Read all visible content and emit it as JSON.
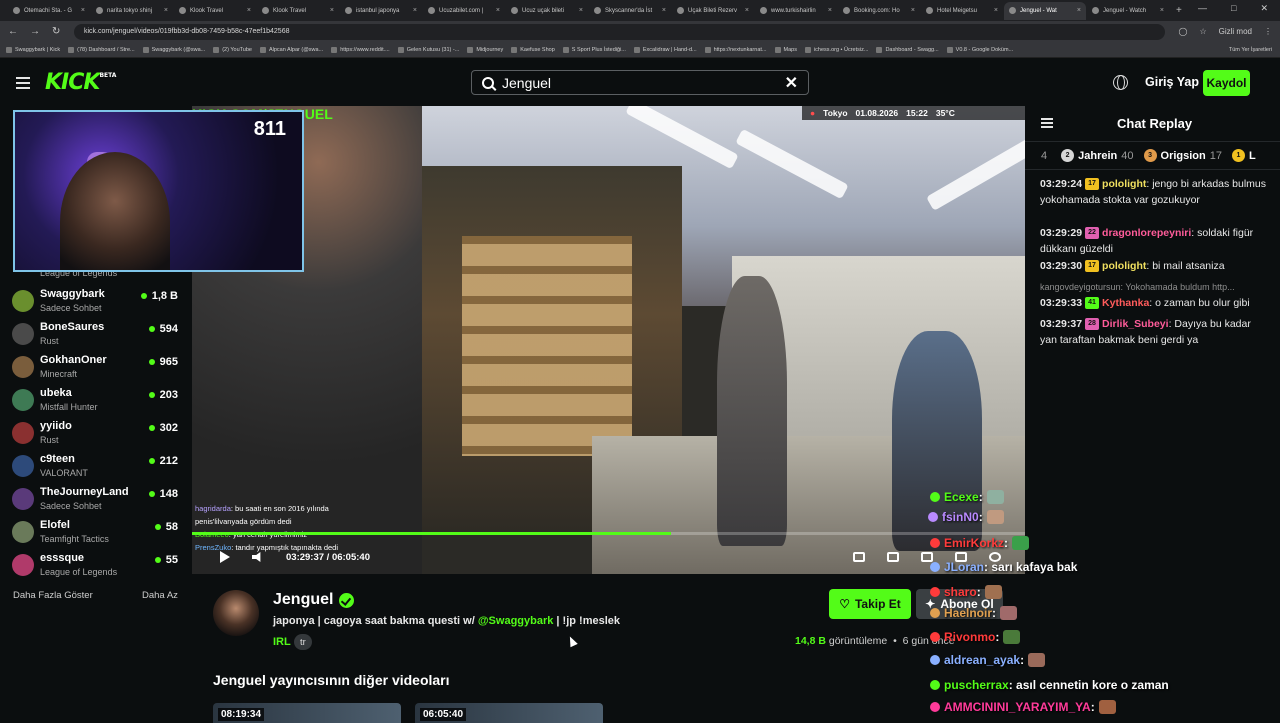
{
  "browser": {
    "tabs": [
      {
        "label": "Otemachi Sta. - G"
      },
      {
        "label": "narita tokyo shinj"
      },
      {
        "label": "Klook Travel"
      },
      {
        "label": "Klook Travel"
      },
      {
        "label": "istanbul japonya"
      },
      {
        "label": "Ucuzabilet.com |"
      },
      {
        "label": "Ucuz uçak bileti"
      },
      {
        "label": "Skyscanner'da İst"
      },
      {
        "label": "Uçak Bileti Rezerv"
      },
      {
        "label": "www.turkishairlin"
      },
      {
        "label": "Booking.com: Ho"
      },
      {
        "label": "Hotel Meigetsu"
      },
      {
        "label": "Jenguel - Wat"
      },
      {
        "label": "Jenguel - Watch"
      }
    ],
    "active_tab_index": 12,
    "url": "kick.com/jenguel/videos/019fbb3d-db08-7459-b58c-47eef1b42568",
    "profile_label": "Gizli mod",
    "bookmarks": [
      "Swaggybark | Kick",
      "(78) Dashboard / Stre...",
      "Swaggybark (@swa...",
      "(2) YouTube",
      "Alpcan Alpar (@swa...",
      "https://www.reddit....",
      "Gelen Kutusu (31) -...",
      "Midjourney",
      "Kaefuse Shop",
      "S Sport Plus İstediği...",
      "Excalidraw | Hand-d...",
      "https://nextunkarnat...",
      "Maps",
      "ichess.org • Ücretsiz...",
      "Dashboard - Swagg...",
      "V0.8 - Google Doküm..."
    ],
    "bookmarks_right": "Tüm Yer İşaretleri"
  },
  "header": {
    "logo": "KICK",
    "logo_sup": "BETA",
    "search_value": "Jenguel",
    "login_label": "Giriş Yap",
    "signup_label": "Kaydol"
  },
  "webcam": {
    "count": "811"
  },
  "sidebar": {
    "top_category": "League of Legends",
    "channels": [
      {
        "name": "Swaggybark",
        "category": "Sadece Sohbet",
        "viewers": "1,8 B",
        "color": "#6a8f2e"
      },
      {
        "name": "BoneSaures",
        "category": "Rust",
        "viewers": "594",
        "color": "#4a4a4a"
      },
      {
        "name": "GokhanOner",
        "category": "Minecraft",
        "viewers": "965",
        "color": "#7a5d3c"
      },
      {
        "name": "ubeka",
        "category": "Mistfall Hunter",
        "viewers": "203",
        "color": "#3e7a54"
      },
      {
        "name": "yyiido",
        "category": "Rust",
        "viewers": "302",
        "color": "#8a3030"
      },
      {
        "name": "c9teen",
        "category": "VALORANT",
        "viewers": "212",
        "color": "#2d4a7a"
      },
      {
        "name": "TheJourneyLand",
        "category": "Sadece Sohbet",
        "viewers": "148",
        "color": "#5a3a7a"
      },
      {
        "name": "Elofel",
        "category": "Teamfight Tactics",
        "viewers": "58",
        "color": "#6a7a5a"
      },
      {
        "name": "esssque",
        "category": "League of Legends",
        "viewers": "55",
        "color": "#b03a6a"
      }
    ],
    "show_more": "Daha Fazla Göster",
    "show_less": "Daha Az"
  },
  "player": {
    "overlay_brand": "KICK.COM/JENGUEL",
    "location": "Tokyo",
    "date": "01.08.2026",
    "clock": "15:22",
    "temperature": "35°C",
    "overlay_chat": [
      {
        "user": "hagridarda",
        "text": ": bu saati en son 2016 yılında"
      },
      {
        "user": "",
        "text": "penis'lilvanyada gördüm dedi"
      },
      {
        "user": "Bolamee0",
        "text": ": yan cenah yürelimimiz"
      },
      {
        "user": "PrensZuko",
        "text": ": tandır yapmıştık tapınakta dedi"
      }
    ],
    "current_time": "03:29:37",
    "duration": "06:05:40",
    "progress": 0.575
  },
  "channel": {
    "name": "Jenguel",
    "title_before": "japonya | cagoya saat bakma questi w/ ",
    "title_mention": "@Swaggybark",
    "title_after": " | !jp !meslek",
    "category": "IRL",
    "tag": "tr",
    "follow_label": "Takip Et",
    "subscribe_label": "Abone Ol",
    "views": "14,8 B",
    "views_label": "görüntüleme",
    "ago": "6 gün önce",
    "more_videos_title": "Jenguel yayıncısının diğer videoları",
    "videos": [
      {
        "duration": "08:19:34"
      },
      {
        "duration": "06:05:40"
      }
    ]
  },
  "chat": {
    "title": "Chat Replay",
    "leaderboard": [
      {
        "rank": "4",
        "name": "",
        "count": ""
      },
      {
        "rank": "2",
        "name": "Jahrein",
        "count": "40",
        "color": "#d6d6d6"
      },
      {
        "rank": "3",
        "name": "Origsion",
        "count": "17",
        "color": "#e09a4a"
      },
      {
        "rank": "1",
        "name": "L",
        "count": "",
        "color": "#f0c020"
      }
    ],
    "messages": [
      {
        "time": "03:29:24",
        "badge": "17",
        "badge_color": "#f0c020",
        "user": "pololight",
        "user_color": "#f0e060",
        "text": ": jengo bi arkadas bulmus yokohamada stokta var gozukuyor"
      },
      {
        "time": "03:29:29",
        "badge": "22",
        "badge_color": "#e060b0",
        "user": "dragonlorepeyniri",
        "user_color": "#ff5c9a",
        "text": ": soldaki figür dükkanı güzeldi"
      },
      {
        "time": "03:29:30",
        "badge": "17",
        "badge_color": "#f0c020",
        "user": "pololight",
        "user_color": "#f0e060",
        "text": ": bi mail atsaniza"
      },
      {
        "time": "03:29:33",
        "badge": "41",
        "badge_color": "#53fc18",
        "user": "Kythanka",
        "user_color": "#ff5c5c",
        "text": ": o zaman bu olur gibi",
        "reply": "kangovdeyigotursun: Yokohamada buldum http..."
      },
      {
        "time": "03:29:37",
        "badge": "28",
        "badge_color": "#e060b0",
        "user": "Dirlik_Subeyi",
        "user_color": "#ff5c9a",
        "text": ": Dayıya bu kadar yan taraftan bakmak beni gerdi ya"
      }
    ]
  },
  "floating_chat": [
    {
      "user": "Ecexe",
      "text": " :",
      "color": "#53fc18"
    },
    {
      "user": "fsinN0",
      "text": " :",
      "color": "#b98aff"
    },
    {
      "user": "EmirKorkz",
      "text": " :",
      "color": "#ff3b3b"
    },
    {
      "user": "JLoran",
      "text": " : sarı kafaya bak",
      "color": "#8ab0ff"
    },
    {
      "user": "sharo",
      "text": " :",
      "color": "#ff3b3b"
    },
    {
      "user": "Haelnoir",
      "text": " :",
      "color": "#e0a050"
    },
    {
      "user": "Rivonmo",
      "text": " :",
      "color": "#ff3b3b"
    },
    {
      "user": "aldrean_ayak",
      "text": " :",
      "color": "#8ab0ff"
    },
    {
      "user": "puscherrax",
      "text": " : asıl cennetin kore o zaman",
      "color": "#53fc18"
    },
    {
      "user": "AMMCININI_YARAYIM_YA",
      "text": " :",
      "color": "#ff3b9a"
    }
  ]
}
